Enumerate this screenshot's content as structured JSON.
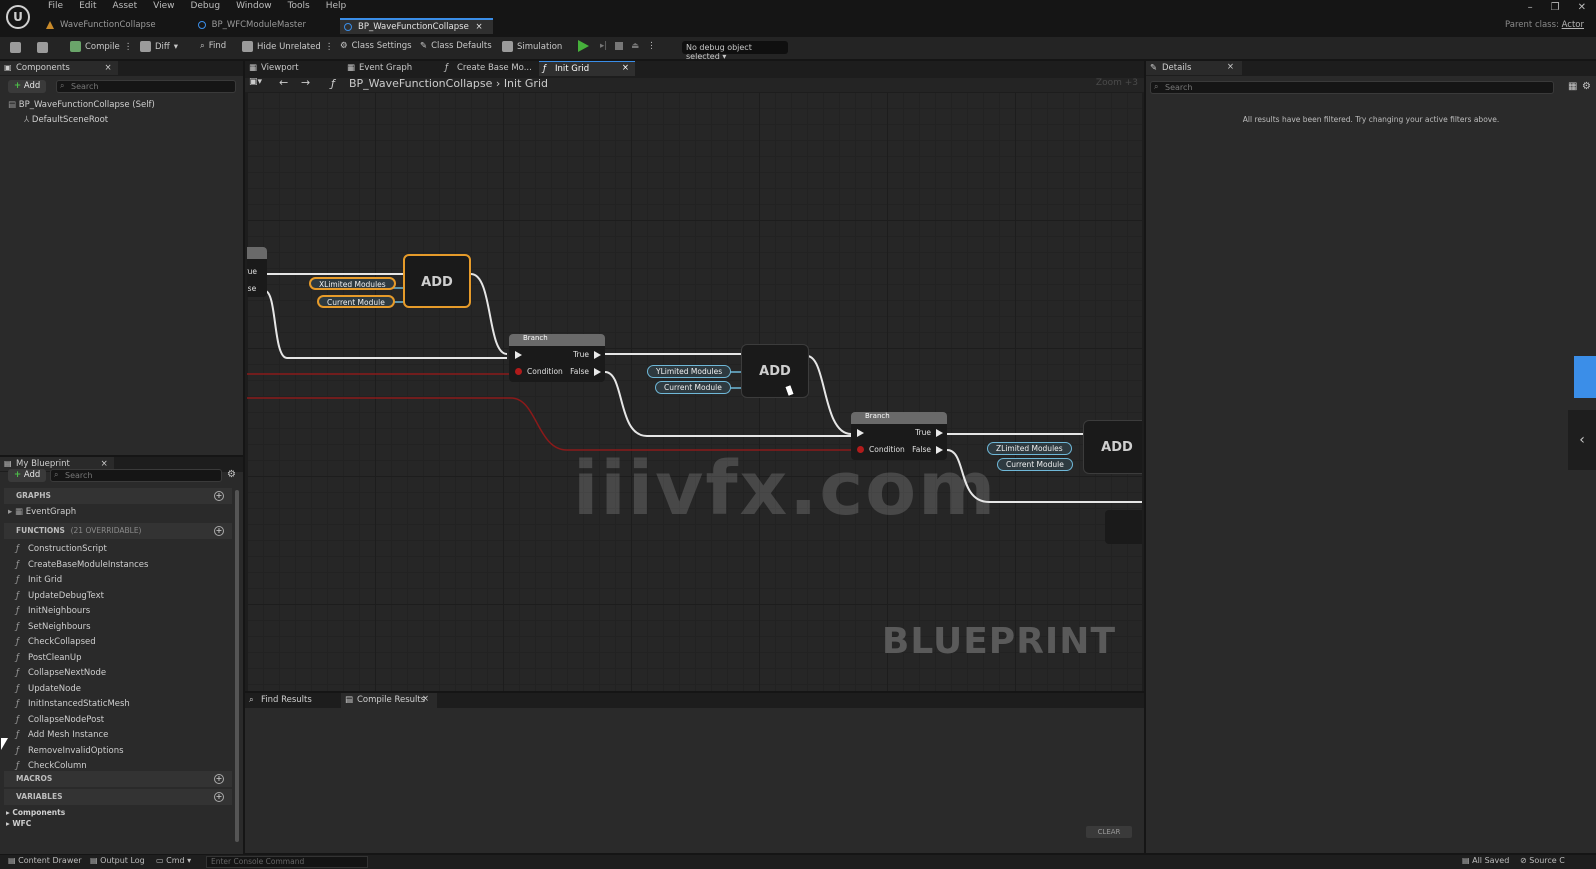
{
  "app": {
    "menu": [
      "File",
      "Edit",
      "Asset",
      "View",
      "Debug",
      "Window",
      "Tools",
      "Help"
    ],
    "document_tabs": [
      {
        "label": "WaveFunctionCollapse",
        "active": false
      },
      {
        "label": "BP_WFCModuleMaster",
        "active": false
      },
      {
        "label": "BP_WaveFunctionCollapse",
        "active": true
      }
    ],
    "parent_class_label": "Parent class:",
    "parent_class_value": "Actor"
  },
  "toolbar": {
    "compile": "Compile",
    "diff": "Diff",
    "find": "Find",
    "hide_unrelated": "Hide Unrelated",
    "class_settings": "Class Settings",
    "class_defaults": "Class Defaults",
    "simulation": "Simulation",
    "debug_object": "No debug object selected"
  },
  "components_panel": {
    "title": "Components",
    "add": "Add",
    "search_placeholder": "Search",
    "items": [
      "BP_WaveFunctionCollapse (Self)",
      "DefaultSceneRoot"
    ]
  },
  "editor_tabs": [
    "Viewport",
    "Event Graph",
    "Create Base Mo...",
    "Init Grid"
  ],
  "breadcrumb": {
    "root": "BP_WaveFunctionCollapse",
    "current": "Init Grid",
    "zoom": "Zoom +3"
  },
  "my_blueprint": {
    "title": "My Blueprint",
    "add": "Add",
    "search_placeholder": "Search",
    "graphs_label": "GRAPHS",
    "graphs": [
      "EventGraph"
    ],
    "functions_label": "FUNCTIONS",
    "functions_count": "(21 OVERRIDABLE)",
    "functions": [
      "ConstructionScript",
      "CreateBaseModuleInstances",
      "Init Grid",
      "UpdateDebugText",
      "InitNeighbours",
      "SetNeighbours",
      "CheckCollapsed",
      "PostCleanUp",
      "CollapseNextNode",
      "UpdateNode",
      "InitInstancedStaticMesh",
      "CollapseNodePost",
      "Add Mesh Instance",
      "RemoveInvalidOptions",
      "CheckColumn"
    ],
    "macros_label": "MACROS",
    "variables_label": "VARIABLES",
    "variables": [
      "Components",
      "WFC"
    ]
  },
  "graph": {
    "add_label": "ADD",
    "branch_title": "Branch",
    "branch_true": "True",
    "branch_false": "False",
    "branch_condition": "Condition",
    "x_modules": "XLimited Modules",
    "y_modules": "YLimited Modules",
    "z_modules": "ZLimited Modules",
    "current_module": "Current Module",
    "edge_true": "True",
    "edge_false": "alse",
    "bp_watermark": "BLUEPRINT",
    "site_watermark": "iiivfx.com"
  },
  "bottom_tabs": {
    "find_results": "Find Results",
    "compile_results": "Compile Results",
    "clear": "CLEAR"
  },
  "details": {
    "title": "Details",
    "search_placeholder": "Search",
    "message": "All results have been filtered. Try changing your active filters above."
  },
  "statusbar": {
    "content_drawer": "Content Drawer",
    "output_log": "Output Log",
    "cmd": "Cmd",
    "console_placeholder": "Enter Console Command",
    "all_saved": "All Saved",
    "source_control": "Source C"
  }
}
